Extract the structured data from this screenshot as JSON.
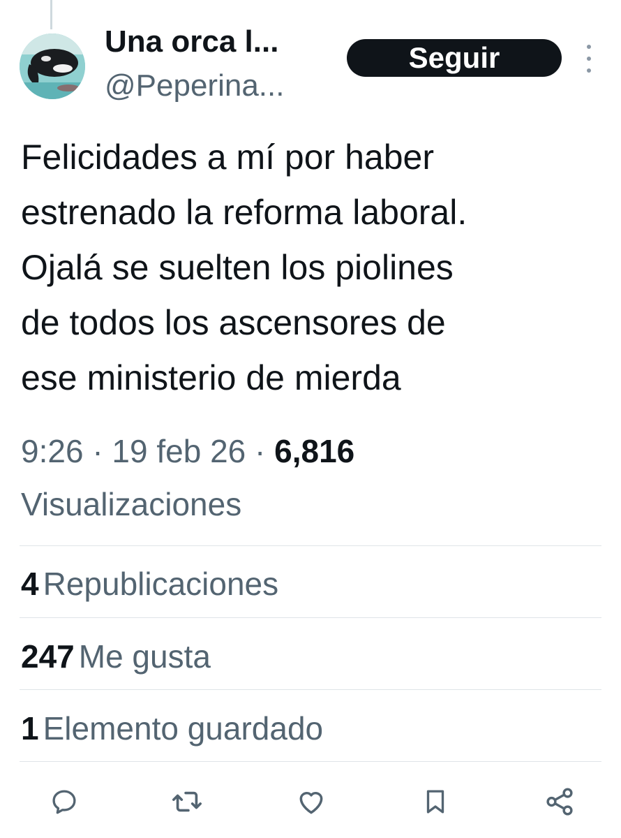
{
  "author": {
    "display_name": "Una orca l...",
    "handle": "@Peperina...",
    "avatar": "orca-photo-avatar"
  },
  "follow_button": {
    "label": "Seguir"
  },
  "more_menu": {
    "icon": "more-vertical-icon"
  },
  "tweet": {
    "lines": [
      "Felicidades a mí por haber",
      "estrenado la reforma laboral.",
      "Ojalá se suelten los piolines",
      "de todos los ascensores de",
      "ese ministerio de mierda"
    ]
  },
  "meta": {
    "time": "9:26",
    "separator": "·",
    "date": "19 feb 26",
    "views_count": "6,816",
    "views_label": "Visualizaciones"
  },
  "stats": {
    "reposts": {
      "count": "4",
      "label": "Republicaciones"
    },
    "likes": {
      "count": "247",
      "label": "Me gusta"
    },
    "bookmarks": {
      "count": "1",
      "label": "Elemento guardado"
    }
  },
  "actions": [
    "reply-icon",
    "repost-icon",
    "like-icon",
    "bookmark-icon",
    "share-icon"
  ],
  "colors": {
    "primary_text": "#0f1419",
    "secondary_text": "#536471",
    "button_bg": "#0f1419",
    "divider": "#dfe4e8"
  }
}
